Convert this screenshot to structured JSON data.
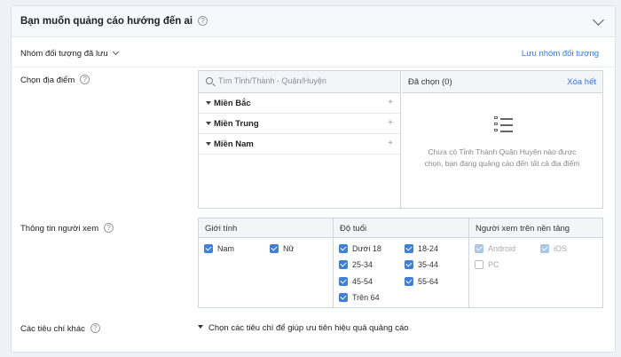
{
  "header": {
    "title": "Bạn muốn quảng cáo hướng đến ai",
    "help": "?"
  },
  "saved_audience": {
    "label": "Nhóm đối tượng đã lưu",
    "save_link": "Lưu nhóm đối tượng"
  },
  "location": {
    "label": "Chọn địa điểm",
    "search_placeholder": "Tìm Tỉnh/Thành - Quận/Huyện",
    "regions": [
      "Miền Bắc",
      "Miền Trung",
      "Miền Nam"
    ],
    "selected_label": "Đã chọn (0)",
    "clear_all": "Xóa hết",
    "empty_message": "Chưa có Tỉnh Thành Quận Huyện nào được chọn, bạn đang quảng cáo đến tất cả địa điểm"
  },
  "viewer_info": {
    "label": "Thông tin người xem",
    "gender": {
      "header": "Giới tính",
      "options": [
        {
          "label": "Nam",
          "checked": true
        },
        {
          "label": "Nữ",
          "checked": true
        }
      ]
    },
    "age": {
      "header": "Độ tuổi",
      "options": [
        {
          "label": "Dưới 18",
          "checked": true
        },
        {
          "label": "18-24",
          "checked": true
        },
        {
          "label": "25-34",
          "checked": true
        },
        {
          "label": "35-44",
          "checked": true
        },
        {
          "label": "45-54",
          "checked": true
        },
        {
          "label": "55-64",
          "checked": true
        },
        {
          "label": "Trên 64",
          "checked": true
        }
      ]
    },
    "platform": {
      "header": "Người xem trên nền tảng",
      "options": [
        {
          "label": "Android",
          "checked": true,
          "disabled": true
        },
        {
          "label": "iOS",
          "checked": true,
          "disabled": true
        },
        {
          "label": "PC",
          "checked": false,
          "disabled": true
        }
      ]
    }
  },
  "other_criteria": {
    "label": "Các tiêu chí khác",
    "expander": "Chọn các tiêu chí để giúp ưu tiên hiệu quả quảng cáo"
  },
  "colors": {
    "accent": "#3578e5",
    "checkbox": "#3d7fd9"
  }
}
